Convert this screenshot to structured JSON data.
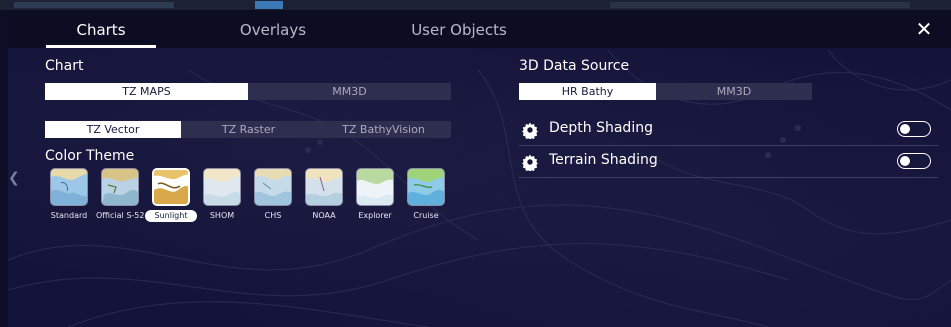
{
  "tabs": [
    {
      "label": "Charts",
      "active": true
    },
    {
      "label": "Overlays",
      "active": false
    },
    {
      "label": "User Objects",
      "active": false
    }
  ],
  "close_icon": "close-icon",
  "left": {
    "chart_label": "Chart",
    "chart_options": [
      {
        "label": "TZ MAPS",
        "selected": true
      },
      {
        "label": "MM3D",
        "selected": false
      }
    ],
    "map_type_options": [
      {
        "label": "TZ Vector",
        "selected": true
      },
      {
        "label": "TZ Raster",
        "selected": false
      },
      {
        "label": "TZ BathyVision",
        "selected": false
      }
    ],
    "color_theme_label": "Color Theme",
    "themes": [
      {
        "label": "Standard",
        "selected": false
      },
      {
        "label": "Official S-52",
        "selected": false
      },
      {
        "label": "Sunlight",
        "selected": true
      },
      {
        "label": "SHOM",
        "selected": false
      },
      {
        "label": "CHS",
        "selected": false
      },
      {
        "label": "NOAA",
        "selected": false
      },
      {
        "label": "Explorer",
        "selected": false
      },
      {
        "label": "Cruise",
        "selected": false
      }
    ]
  },
  "right": {
    "data_source_label": "3D Data Source",
    "data_source_options": [
      {
        "label": "HR Bathy",
        "selected": true
      },
      {
        "label": "MM3D",
        "selected": false
      }
    ],
    "settings": [
      {
        "label": "Depth Shading",
        "icon": "gear-icon",
        "enabled": false
      },
      {
        "label": "Terrain Shading",
        "icon": "gear-icon",
        "enabled": false
      }
    ]
  },
  "colors": {
    "background": "#14143a",
    "tab_bar": "#0c0c22",
    "selected_segment": "#ffffff",
    "unselected_segment": "#2e2e4e"
  }
}
